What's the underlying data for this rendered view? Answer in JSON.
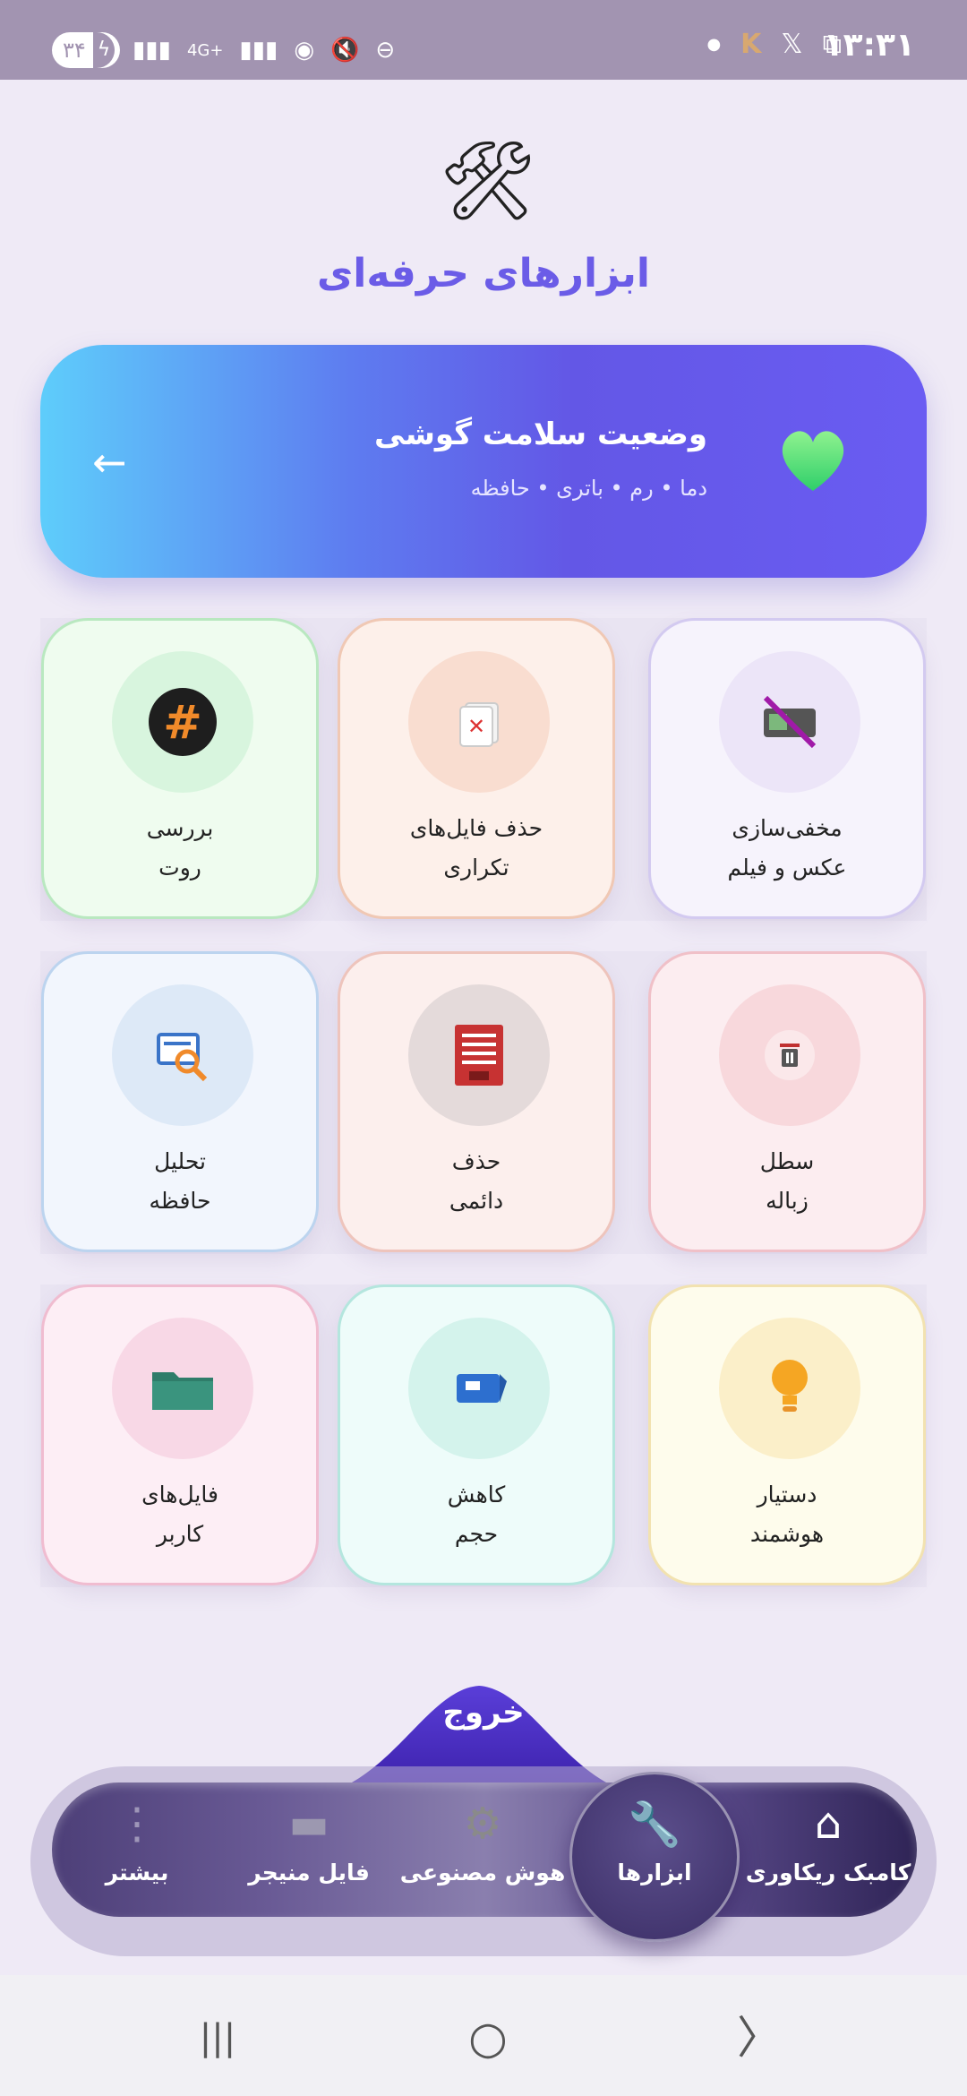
{
  "status_bar": {
    "battery": "۳۴",
    "network": "4G+",
    "time": "۱۳:۳۱",
    "left_icons": [
      "signal-icon",
      "data-icon",
      "signal-icon",
      "hotspot-icon",
      "mute-icon",
      "dnd-icon"
    ],
    "right_icons": [
      "dot-icon",
      "k-app-icon",
      "x-icon",
      "screenshot-icon"
    ]
  },
  "header": {
    "icon": "tools-icon",
    "title": "ابزارهای حرفه‌ای"
  },
  "health_card": {
    "title": "وضعیت سلامت گوشی",
    "subtitle": "دما • رم • باتری • حافظه",
    "icon": "green-heart-icon",
    "arrow": "←"
  },
  "tools": [
    {
      "line1": "مخفی‌سازی",
      "line2": "عکس و فیلم",
      "icon": "hide-media-icon"
    },
    {
      "line1": "حذف فایل‌های",
      "line2": "تکراری",
      "icon": "duplicate-delete-icon"
    },
    {
      "line1": "بررسی",
      "line2": "روت",
      "icon": "root-check-icon"
    },
    {
      "line1": "سطل",
      "line2": "زباله",
      "icon": "trash-icon"
    },
    {
      "line1": "حذف",
      "line2": "دائمی",
      "icon": "shredder-icon"
    },
    {
      "line1": "تحلیل",
      "line2": "حافظه",
      "icon": "memory-analysis-icon"
    },
    {
      "line1": "دستیار",
      "line2": "هوشمند",
      "icon": "lightbulb-icon"
    },
    {
      "line1": "کاهش",
      "line2": "حجم",
      "icon": "compress-icon"
    },
    {
      "line1": "فایل‌های",
      "line2": "کاربر",
      "icon": "folder-icon"
    }
  ],
  "exit_label": "خروج",
  "bottom_nav": {
    "items": [
      {
        "label": "کامبک ریکاوری",
        "icon": "home-icon"
      },
      {
        "label": "ابزارها",
        "icon": "wrench-icon",
        "active": true
      },
      {
        "label": "هوش مصنوعی",
        "icon": "ai-gear-icon"
      },
      {
        "label": "فایل منیجر",
        "icon": "folder-icon"
      },
      {
        "label": "بیشتر",
        "icon": "more-vertical-icon"
      }
    ]
  },
  "system_nav": {
    "recents": "|||",
    "home": "○",
    "back": "〉"
  },
  "colors": {
    "accent": "#6b5ce7",
    "status_bar": "#a294b1",
    "background": "#efeaf6"
  }
}
